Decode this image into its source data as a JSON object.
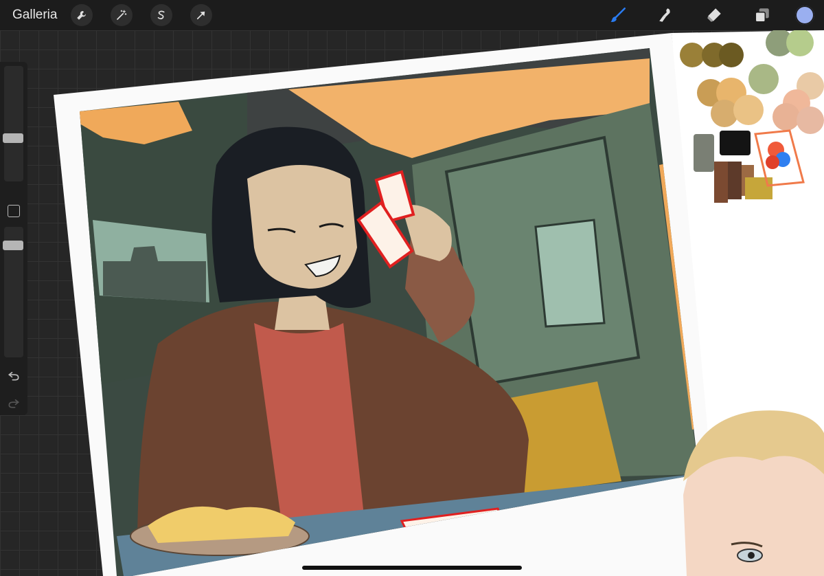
{
  "toolbar": {
    "gallery_label": "Galleria",
    "left_tools": [
      {
        "icon": "wrench-icon",
        "name": "actions"
      },
      {
        "icon": "magic-wand-icon",
        "name": "adjustments"
      },
      {
        "icon": "selection-s-icon",
        "name": "selection"
      },
      {
        "icon": "transform-arrow-icon",
        "name": "transform"
      }
    ],
    "right_tools": [
      {
        "icon": "brush-icon",
        "name": "brush",
        "active": true
      },
      {
        "icon": "smudge-icon",
        "name": "smudge"
      },
      {
        "icon": "eraser-icon",
        "name": "eraser"
      },
      {
        "icon": "layers-icon",
        "name": "layers"
      }
    ],
    "current_color": "#9aaff0",
    "active_color": "#2a7bf0"
  },
  "sidebar": {
    "brush_size": 0.55,
    "opacity": 0.9
  }
}
